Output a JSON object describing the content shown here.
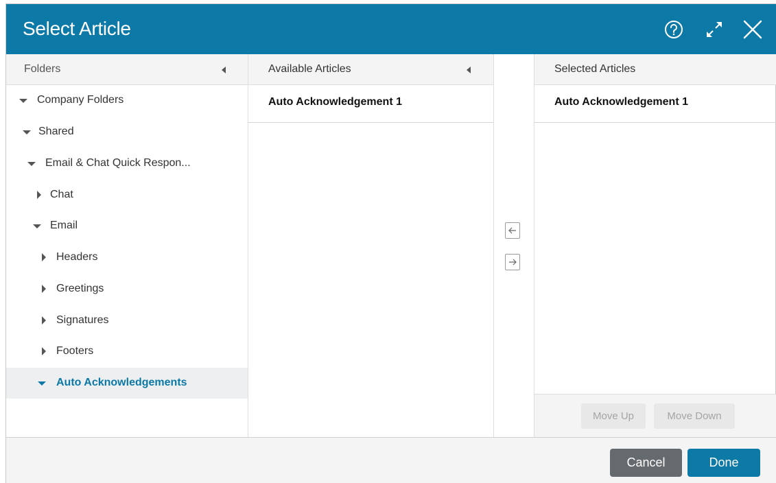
{
  "dialog": {
    "title": "Select Article",
    "icons": [
      "help-icon",
      "expand-icon",
      "close-icon"
    ]
  },
  "folders": {
    "header": "Folders",
    "tree": [
      {
        "label": "Company Folders",
        "expanded": true,
        "level": 0
      },
      {
        "label": "Shared",
        "expanded": true,
        "level": 0
      },
      {
        "label": "Email & Chat Quick Respon...",
        "expanded": true,
        "level": 1
      },
      {
        "label": "Chat",
        "expanded": false,
        "level": 2
      },
      {
        "label": "Email",
        "expanded": true,
        "level": 2
      },
      {
        "label": "Headers",
        "expanded": false,
        "level": 3
      },
      {
        "label": "Greetings",
        "expanded": false,
        "level": 3
      },
      {
        "label": "Signatures",
        "expanded": false,
        "level": 3
      },
      {
        "label": "Footers",
        "expanded": false,
        "level": 3
      },
      {
        "label": "Auto Acknowledgements",
        "expanded": true,
        "level": 3,
        "selected": true
      }
    ]
  },
  "available": {
    "header": "Available Articles",
    "items": [
      "Auto Acknowledgement 1"
    ]
  },
  "transfer": {
    "left_icon": "arrow-left-icon",
    "right_icon": "arrow-right-icon"
  },
  "selected": {
    "header": "Selected Articles",
    "items": [
      "Auto Acknowledgement 1"
    ],
    "move_up": "Move Up",
    "move_down": "Move Down"
  },
  "footer": {
    "cancel": "Cancel",
    "done": "Done"
  },
  "colors": {
    "brand": "#0c79a6",
    "cancel_bg": "#646a6e",
    "selected_row_bg": "#eeeff0"
  }
}
